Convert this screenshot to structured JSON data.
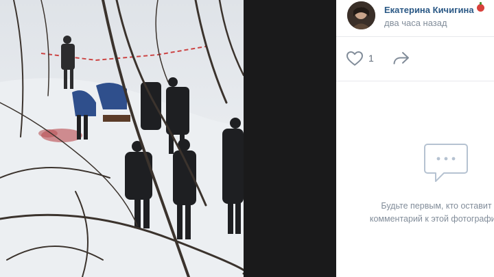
{
  "post": {
    "author_name": "Екатерина Кичигина",
    "time": "два часа назад",
    "likes_count": "1"
  },
  "comments": {
    "empty_line1": "Будьте первым, кто оставит",
    "empty_line2": "комментарий к этой фотографии."
  },
  "icons": {
    "like": "heart-icon",
    "share": "share-arrow-icon",
    "comments": "comments-bubble-icon",
    "badge": "apple-badge-icon"
  },
  "colors": {
    "author_link": "#2a5885",
    "secondary_text": "#818c99",
    "icon_gray": "#818c99",
    "divider": "#e7e8ec"
  }
}
